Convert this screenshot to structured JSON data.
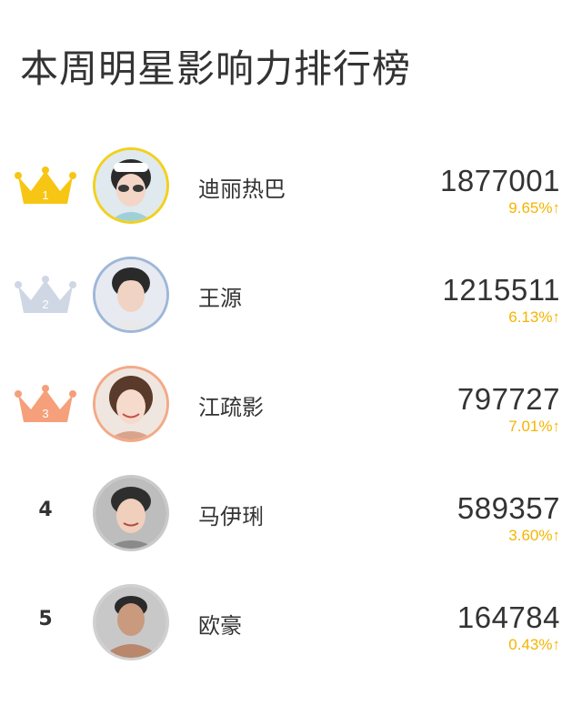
{
  "title": "本周明星影响力排行榜",
  "colors": {
    "gold": "#f7c614",
    "silver": "#cfd7e4",
    "bronze": "#f5a07a",
    "change_up": "#f5b400",
    "text": "#333333"
  },
  "rankings": [
    {
      "rank": "1",
      "badge": "crown-gold-icon",
      "name": "迪丽热巴",
      "score": "1877001",
      "change": "9.65%↑",
      "avatar_border": "#f2d01e"
    },
    {
      "rank": "2",
      "badge": "crown-silver-icon",
      "name": "王源",
      "score": "1215511",
      "change": "6.13%↑",
      "avatar_border": "#9fb7d8"
    },
    {
      "rank": "3",
      "badge": "crown-bronze-icon",
      "name": "江疏影",
      "score": "797727",
      "change": "7.01%↑",
      "avatar_border": "#f3a987"
    },
    {
      "rank": "4",
      "badge": "",
      "name": "马伊琍",
      "score": "589357",
      "change": "3.60%↑",
      "avatar_border": "#c9c9c9"
    },
    {
      "rank": "5",
      "badge": "",
      "name": "欧豪",
      "score": "164784",
      "change": "0.43%↑",
      "avatar_border": "#d0d0d0"
    }
  ]
}
